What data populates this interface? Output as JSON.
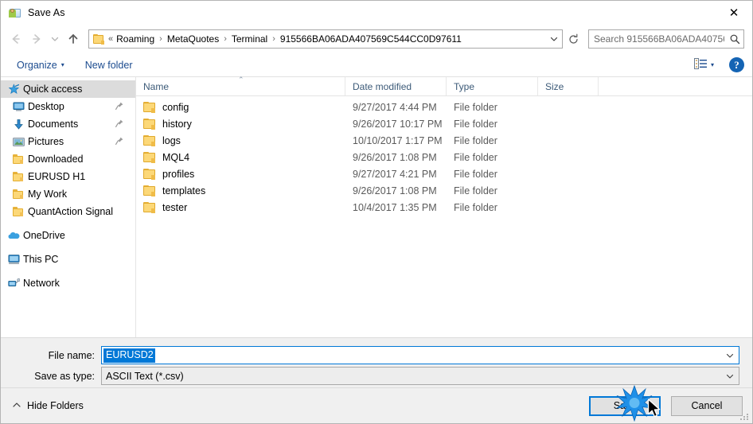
{
  "window": {
    "title": "Save As",
    "title_icon": "save-as-folder-icon",
    "close_icon": "close-icon"
  },
  "nav": {
    "back_icon": "arrow-left-icon",
    "forward_icon": "arrow-right-icon",
    "recent_icon": "chevron-down-icon",
    "up_icon": "arrow-up-icon",
    "address_folder_icon": "folder-icon",
    "address_prefix": "«",
    "breadcrumbs": [
      "Roaming",
      "MetaQuotes",
      "Terminal",
      "915566BA06ADA407569C544CC0D97611"
    ],
    "separator": "›",
    "address_dropdown_icon": "chevron-down-icon",
    "refresh_icon": "refresh-icon"
  },
  "search": {
    "placeholder": "Search 915566BA06ADA40756...",
    "value": "",
    "icon": "search-icon"
  },
  "toolbar": {
    "organize_label": "Organize",
    "organize_caret": "▾",
    "new_folder_label": "New folder",
    "view_icon": "details-view-icon",
    "view_caret": "▾",
    "help_label": "?",
    "help_icon": "help-icon"
  },
  "sidebar": {
    "items": [
      {
        "label": "Quick access",
        "icon": "star-pin-icon",
        "selected": true,
        "indent": false,
        "pinned": false
      },
      {
        "label": "Desktop",
        "icon": "monitor-icon",
        "selected": false,
        "indent": true,
        "pinned": true
      },
      {
        "label": "Documents",
        "icon": "download-arrow-icon",
        "selected": false,
        "indent": true,
        "pinned": true
      },
      {
        "label": "Pictures",
        "icon": "picture-icon",
        "selected": false,
        "indent": true,
        "pinned": true
      },
      {
        "label": "Downloaded",
        "icon": "folder-icon",
        "selected": false,
        "indent": true,
        "pinned": false
      },
      {
        "label": "EURUSD H1",
        "icon": "folder-icon",
        "selected": false,
        "indent": true,
        "pinned": false
      },
      {
        "label": "My Work",
        "icon": "folder-icon",
        "selected": false,
        "indent": true,
        "pinned": false
      },
      {
        "label": "QuantAction Signal",
        "icon": "folder-icon",
        "selected": false,
        "indent": true,
        "pinned": false
      },
      {
        "label": "OneDrive",
        "icon": "cloud-icon",
        "selected": false,
        "indent": false,
        "pinned": false,
        "gap_before": true
      },
      {
        "label": "This PC",
        "icon": "computer-icon",
        "selected": false,
        "indent": false,
        "pinned": false,
        "gap_before": true
      },
      {
        "label": "Network",
        "icon": "network-icon",
        "selected": false,
        "indent": false,
        "pinned": false,
        "gap_before": true
      }
    ]
  },
  "filelist": {
    "columns": [
      "Name",
      "Date modified",
      "Type",
      "Size"
    ],
    "sort_column": "Name",
    "sort_caret": "⌃",
    "rows": [
      {
        "name": "config",
        "date": "9/27/2017 4:44 PM",
        "type": "File folder",
        "size": "",
        "icon": "folder-icon"
      },
      {
        "name": "history",
        "date": "9/26/2017 10:17 PM",
        "type": "File folder",
        "size": "",
        "icon": "folder-icon"
      },
      {
        "name": "logs",
        "date": "10/10/2017 1:17 PM",
        "type": "File folder",
        "size": "",
        "icon": "folder-icon"
      },
      {
        "name": "MQL4",
        "date": "9/26/2017 1:08 PM",
        "type": "File folder",
        "size": "",
        "icon": "folder-icon"
      },
      {
        "name": "profiles",
        "date": "9/27/2017 4:21 PM",
        "type": "File folder",
        "size": "",
        "icon": "folder-icon"
      },
      {
        "name": "templates",
        "date": "9/26/2017 1:08 PM",
        "type": "File folder",
        "size": "",
        "icon": "folder-icon"
      },
      {
        "name": "tester",
        "date": "10/4/2017 1:35 PM",
        "type": "File folder",
        "size": "",
        "icon": "folder-icon"
      }
    ]
  },
  "form": {
    "filename_label": "File name:",
    "filename_value": "EURUSD2",
    "filename_selected": true,
    "filename_caret": "chevron-down-icon",
    "savetype_label": "Save as type:",
    "savetype_value": "ASCII Text (*.csv)",
    "savetype_caret": "chevron-down-icon"
  },
  "footer": {
    "hide_folders_label": "Hide Folders",
    "hide_folders_icon": "chevron-up-icon",
    "save_label": "Save",
    "cancel_label": "Cancel",
    "resize_grip_icon": "resize-grip-icon"
  },
  "colors": {
    "accent": "#0078d7",
    "selection": "#0078d7",
    "help_blue": "#1464b4",
    "folder_yellow": "#fcd878",
    "link_blue": "#1b4b8f",
    "column_header_text": "#3c5a78",
    "window_bg": "#f0f0f0"
  },
  "pointer": {
    "click_effect": "blue-starburst",
    "cursor_icon": "mouse-pointer-icon",
    "over_element": "save-button"
  }
}
